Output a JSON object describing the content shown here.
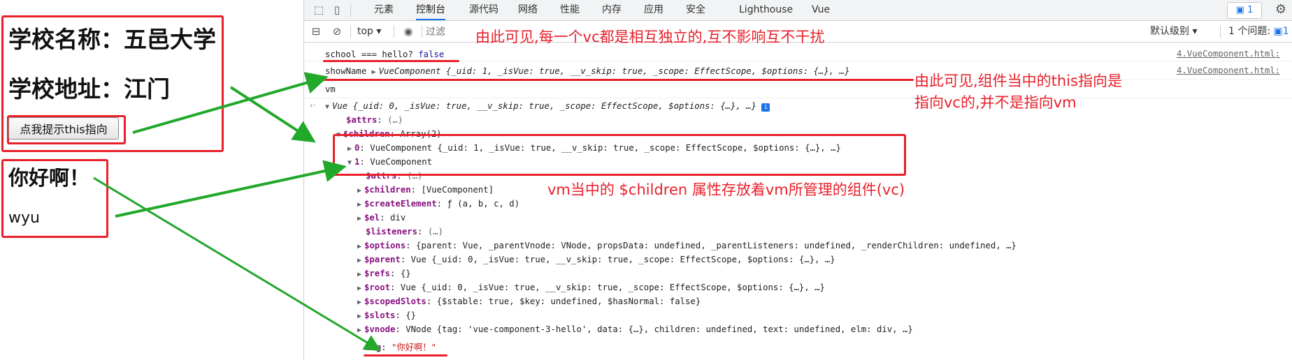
{
  "page": {
    "school_name": "学校名称：五邑大学",
    "school_address": "学校地址：江门",
    "hint_button": "点我提示this指向",
    "greeting": "你好啊！",
    "greeting_name": "wyu"
  },
  "devtools": {
    "tabs": [
      "元素",
      "控制台",
      "源代码",
      "网络",
      "性能",
      "内存",
      "应用",
      "安全",
      "Lighthouse",
      "Vue"
    ],
    "active_tab": "控制台",
    "issues_badge": "1",
    "context": "top",
    "filter_placeholder": "过滤",
    "level": "默认级别",
    "issues_count": "1 个问题:",
    "issues_count_badge": "1"
  },
  "console": {
    "line1": {
      "text": "school === hello?",
      "value": "false",
      "source": "4.VueComponent.html:"
    },
    "line2": {
      "label": "showName",
      "type": "VueComponent",
      "props": "{_uid: 1, _isVue: true, __v_skip: true, _scope: EffectScope, $options: {…}, …}",
      "source": "4.VueComponent.html:"
    },
    "input": "vm",
    "vm_summary": "Vue {_uid: 0, _isVue: true, __v_skip: true, _scope: EffectScope, $options: {…}, …}",
    "attrs": {
      "key": "$attrs",
      "value": "(…)"
    },
    "children": {
      "key": "$children",
      "value": "Array(2)"
    },
    "child0": {
      "key": "0",
      "value": "VueComponent {_uid: 1, _isVue: true, __v_skip: true, _scope: EffectScope, $options: {…}, …}"
    },
    "child1": {
      "key": "1",
      "value": "VueComponent"
    },
    "props": [
      {
        "key": "$attrs",
        "value": "(…)"
      },
      {
        "key": "$children",
        "value": "[VueComponent]"
      },
      {
        "key": "$createElement",
        "value": "ƒ (a, b, c, d)"
      },
      {
        "key": "$el",
        "value": "div"
      },
      {
        "key": "$listeners",
        "value": "(…)"
      },
      {
        "key": "$options",
        "value": "{parent: Vue, _parentVnode: VNode, propsData: undefined, _parentListeners: undefined, _renderChildren: undefined, …}"
      },
      {
        "key": "$parent",
        "value": "Vue {_uid: 0, _isVue: true, __v_skip: true, _scope: EffectScope, $options: {…}, …}"
      },
      {
        "key": "$refs",
        "value": "{}"
      },
      {
        "key": "$root",
        "value": "Vue {_uid: 0, _isVue: true, __v_skip: true, _scope: EffectScope, $options: {…}, …}"
      },
      {
        "key": "$scopedSlots",
        "value": "{$stable: true, $key: undefined, $hasNormal: false}"
      },
      {
        "key": "$slots",
        "value": "{}"
      },
      {
        "key": "$vnode",
        "value": "VNode {tag: 'vue-component-3-hello', data: {…}, children: undefined, text: undefined, elm: div, …}"
      }
    ],
    "msg": {
      "key": "msg",
      "value": "\"你好啊！\""
    }
  },
  "annotations": {
    "a1": "由此可见,每一个vc都是相互独立的,互不影响互不干扰",
    "a2_line1": "由此可见,组件当中的this指向是",
    "a2_line2": "指向vc的,并不是指向vm",
    "a3": "vm当中的 $children 属性存放着vm所管理的组件(vc)"
  },
  "colors": {
    "annotation_red": "#e8202a",
    "arrow_green": "#22a82a",
    "accent_blue": "#1a73e8"
  }
}
